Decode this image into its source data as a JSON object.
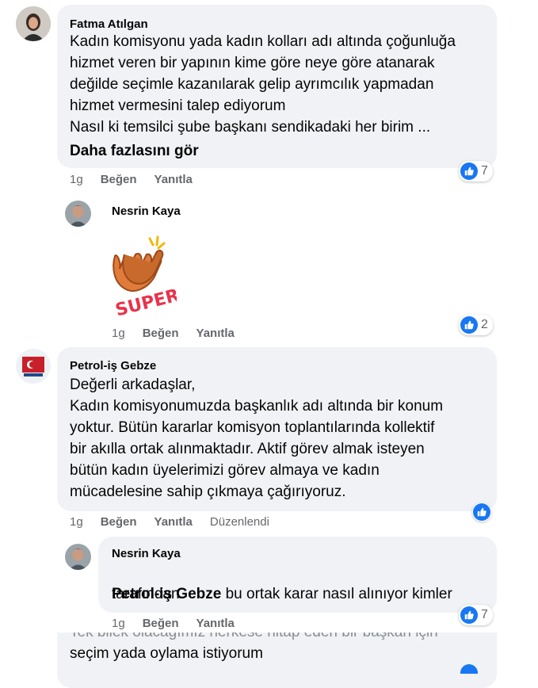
{
  "comments": [
    {
      "author": "Fatma Atılgan",
      "text": "Kadın komisyonu yada kadın kolları adı altında çoğunluğa\nhizmet veren bir yapının kime göre neye göre atanarak\ndeğilde seçimle kazanılarak gelip ayrımcılık yapmadan\nhizmet vermesini talep ediyorum\nNasıl ki temsilci şube başkanı sendikadaki her birim ...",
      "more": "Daha fazlasını gör",
      "time": "1g",
      "like": "Beğen",
      "reply": "Yanıtla",
      "reactions": "7"
    },
    {
      "author": "Nesrin Kaya",
      "sticker": "SUPER!",
      "time": "1g",
      "like": "Beğen",
      "reply": "Yanıtla",
      "reactions": "2"
    },
    {
      "author": "Petrol-iş Gebze",
      "text": "Değerli arkadaşlar,\nKadın komisyonumuzda başkanlık adı altında bir konum\nyoktur. Bütün kararlar komisyon toplantılarında kollektif\nbir akılla ortak alınmaktadır. Aktif görev almak isteyen\nbütün kadın üyelerimizi görev almaya ve kadın\nmücadelesine sahip çıkmaya çağırıyoruz.",
      "time": "1g",
      "like": "Beğen",
      "reply": "Yanıtla",
      "edited": "Düzenlendi"
    },
    {
      "author": "Nesrin Kaya",
      "mention": "Petrol-iş Gebze",
      "text_after": " bu ortak karar nasıl alınıyor kimler",
      "text_line2": "tarafından",
      "time": "1g",
      "like": "Beğen",
      "reply": "Yanıtla",
      "reactions": "7"
    },
    {
      "text_partial": "Tek bilek olacağımız herkese hitap eden bir başkan için",
      "text_last": "seçim yada oylama istiyorum"
    }
  ],
  "colors": {
    "bubble": "#f0f2f5",
    "like": "#1877f2",
    "meta": "#65676b"
  }
}
